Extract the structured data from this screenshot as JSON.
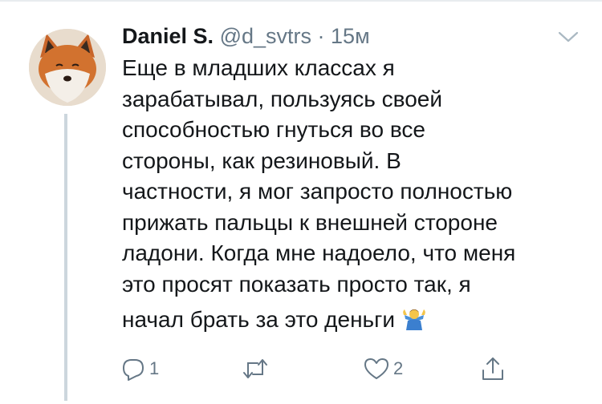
{
  "tweet": {
    "author_name": "Daniel S.",
    "handle": "@d_svtrs",
    "separator": "·",
    "time": "15м",
    "text_lines": [
      "Еще в младших классах я",
      "зарабатывал, пользуясь своей",
      "способностью гнуться во все",
      "стороны, как резиновый. В",
      "частности, я мог запросто полностью",
      "прижать пальцы к внешней стороне",
      "ладони. Когда мне надоело, что меня",
      "это просят показать просто так, я",
      "начал брать за это деньги"
    ],
    "emoji": "shrugging-person-emoji",
    "avatar": "fox-avatar"
  },
  "actions": {
    "reply_count": "1",
    "retweet_count": "",
    "like_count": "2"
  },
  "colors": {
    "text": "#14171a",
    "muted": "#657786",
    "thread_line": "#ccd6dd"
  }
}
